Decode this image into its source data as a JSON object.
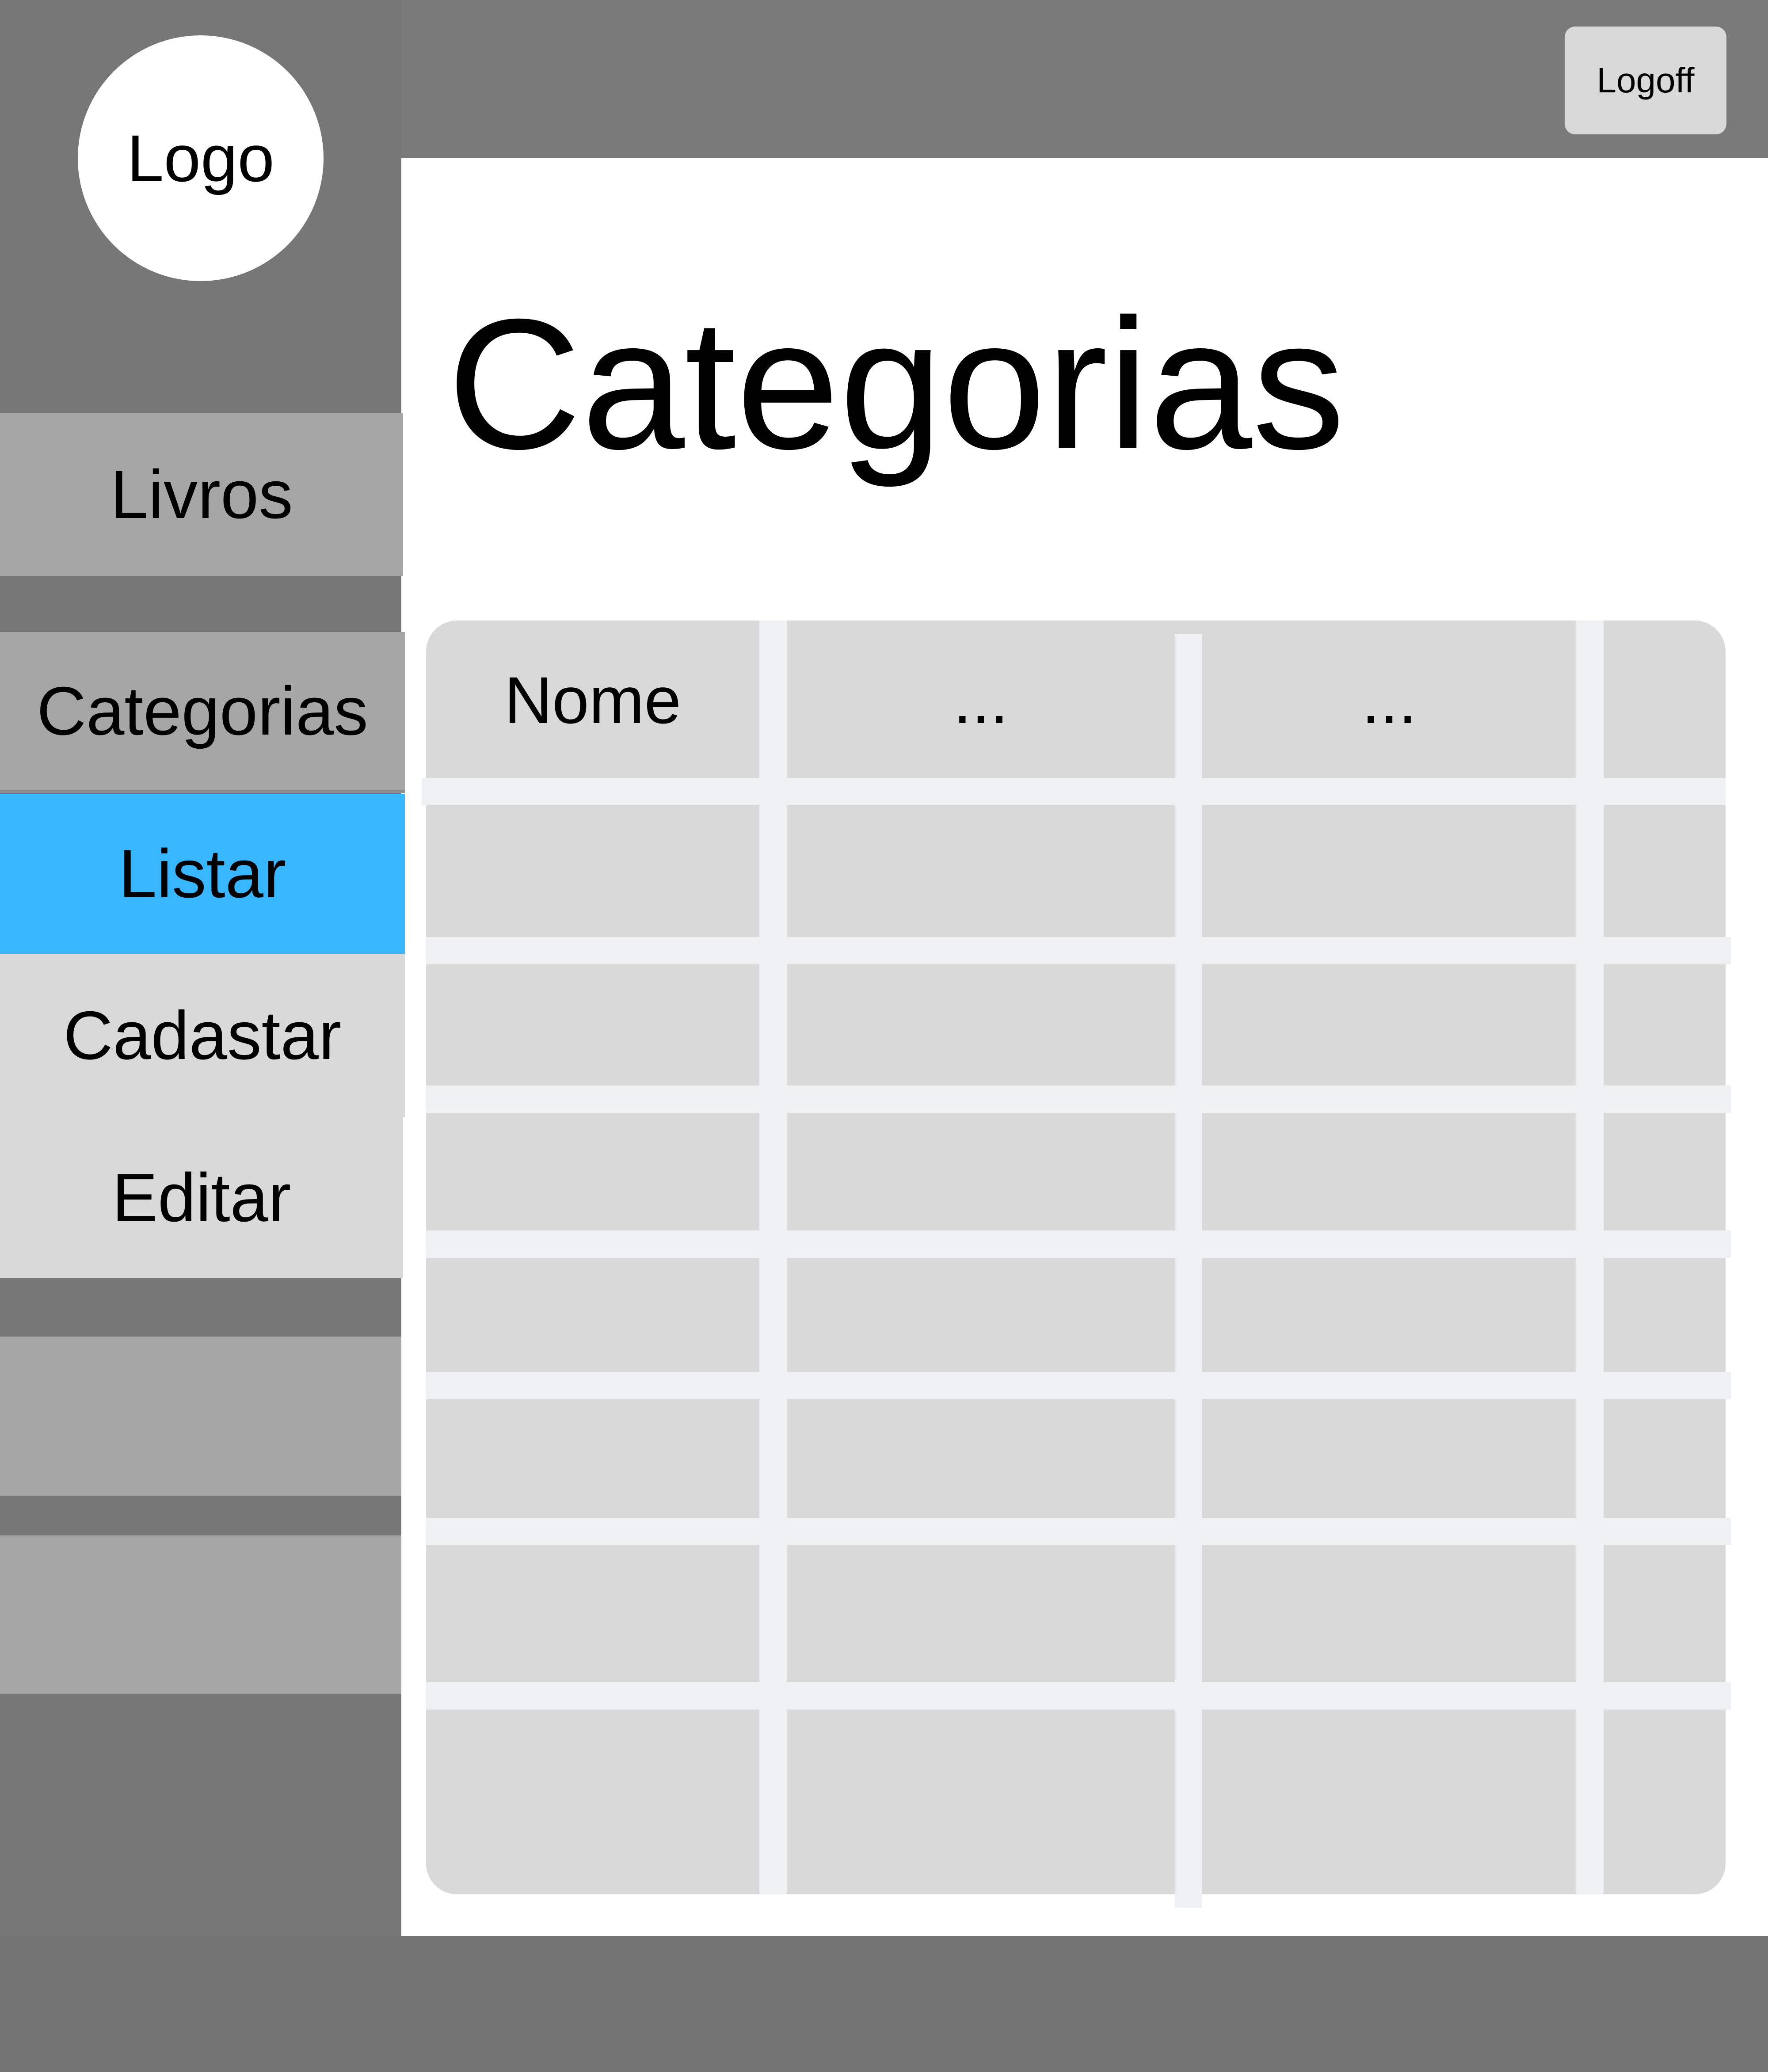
{
  "header": {
    "logo_text": "Logo",
    "logoff_label": "Logoff"
  },
  "sidebar": {
    "items": [
      {
        "label": "Livros"
      },
      {
        "label": "Categorias"
      },
      {
        "label": "Listar",
        "active": true
      },
      {
        "label": "Cadastar"
      },
      {
        "label": "Editar"
      },
      {
        "label": ""
      },
      {
        "label": ""
      }
    ]
  },
  "main": {
    "title": "Categorias",
    "table": {
      "columns": [
        "Nome",
        "...",
        "...",
        ""
      ],
      "row_count": 8
    }
  },
  "colors": {
    "active_nav": "#38b6ff",
    "chrome": "#777777",
    "table_cell": "#d9d9d9",
    "table_grid": "#eff0f1"
  }
}
